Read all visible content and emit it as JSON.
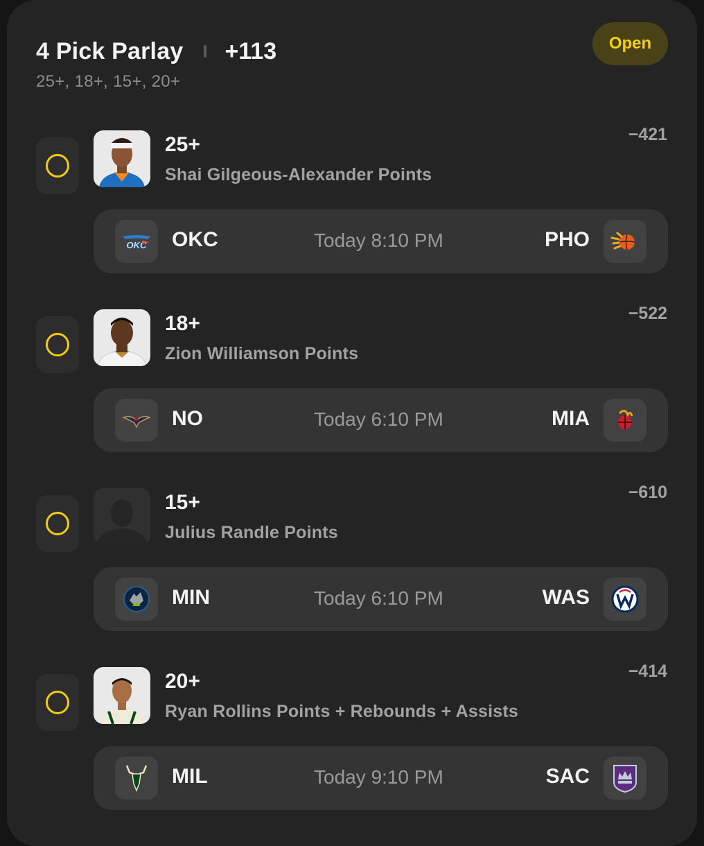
{
  "header": {
    "title": "4 Pick Parlay",
    "odds": "+113",
    "lines_summary": "25+, 18+, 15+, 20+",
    "status": "Open"
  },
  "colors": {
    "accent": "#f3cc12",
    "background": "#151515",
    "card": "#242424",
    "game_row": "#343434"
  },
  "picks": [
    {
      "line": "25+",
      "market": "Shai Gilgeous-Alexander Points",
      "price": "−421",
      "home_team": "OKC",
      "away_team": "PHO",
      "time": "Today 8:10 PM",
      "home_logo": "thunder-logo-icon",
      "away_logo": "suns-logo-icon"
    },
    {
      "line": "18+",
      "market": "Zion Williamson Points",
      "price": "−522",
      "home_team": "NO",
      "away_team": "MIA",
      "time": "Today 6:10 PM",
      "home_logo": "pelicans-logo-icon",
      "away_logo": "heat-logo-icon"
    },
    {
      "line": "15+",
      "market": "Julius Randle Points",
      "price": "−610",
      "home_team": "MIN",
      "away_team": "WAS",
      "time": "Today 6:10 PM",
      "home_logo": "timberwolves-logo-icon",
      "away_logo": "wizards-logo-icon"
    },
    {
      "line": "20+",
      "market": "Ryan Rollins Points + Rebounds + Assists",
      "price": "−414",
      "home_team": "MIL",
      "away_team": "SAC",
      "time": "Today 9:10 PM",
      "home_logo": "bucks-logo-icon",
      "away_logo": "kings-logo-icon"
    }
  ]
}
